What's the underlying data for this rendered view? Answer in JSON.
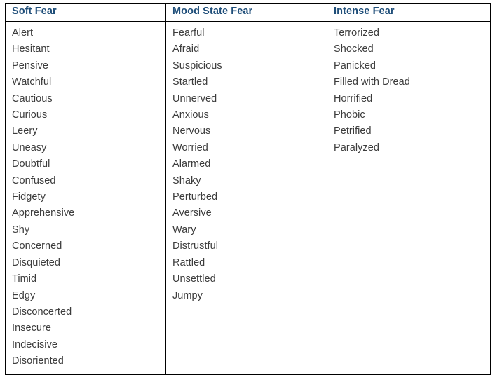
{
  "document": {
    "title": "Fear Words Table",
    "colors": {
      "header_text": "#1F4E79",
      "body_text": "#3C3C3C",
      "border": "#000000",
      "background": "#FFFFFF"
    }
  },
  "table": {
    "columns": [
      {
        "header": "Soft Fear",
        "items": [
          "Alert",
          "Hesitant",
          "Pensive",
          "Watchful",
          "Cautious",
          "Curious",
          "Leery",
          "Uneasy",
          "Doubtful",
          "Confused",
          "Fidgety",
          "Apprehensive",
          "Shy",
          "Concerned",
          "Disquieted",
          "Timid",
          "Edgy",
          "Disconcerted",
          "Insecure",
          "Indecisive",
          "Disoriented"
        ]
      },
      {
        "header": "Mood State Fear",
        "items": [
          "Fearful",
          "Afraid",
          "Suspicious",
          "Startled",
          "Unnerved",
          "Anxious",
          "Nervous",
          "Worried",
          "Alarmed",
          "Shaky",
          "Perturbed",
          "Aversive",
          "Wary",
          "Distrustful",
          "Rattled",
          "Unsettled",
          "Jumpy"
        ]
      },
      {
        "header": "Intense Fear",
        "items": [
          "Terrorized",
          "Shocked",
          "Panicked",
          "Filled with Dread",
          "Horrified",
          "Phobic",
          "Petrified",
          "Paralyzed"
        ]
      }
    ]
  }
}
